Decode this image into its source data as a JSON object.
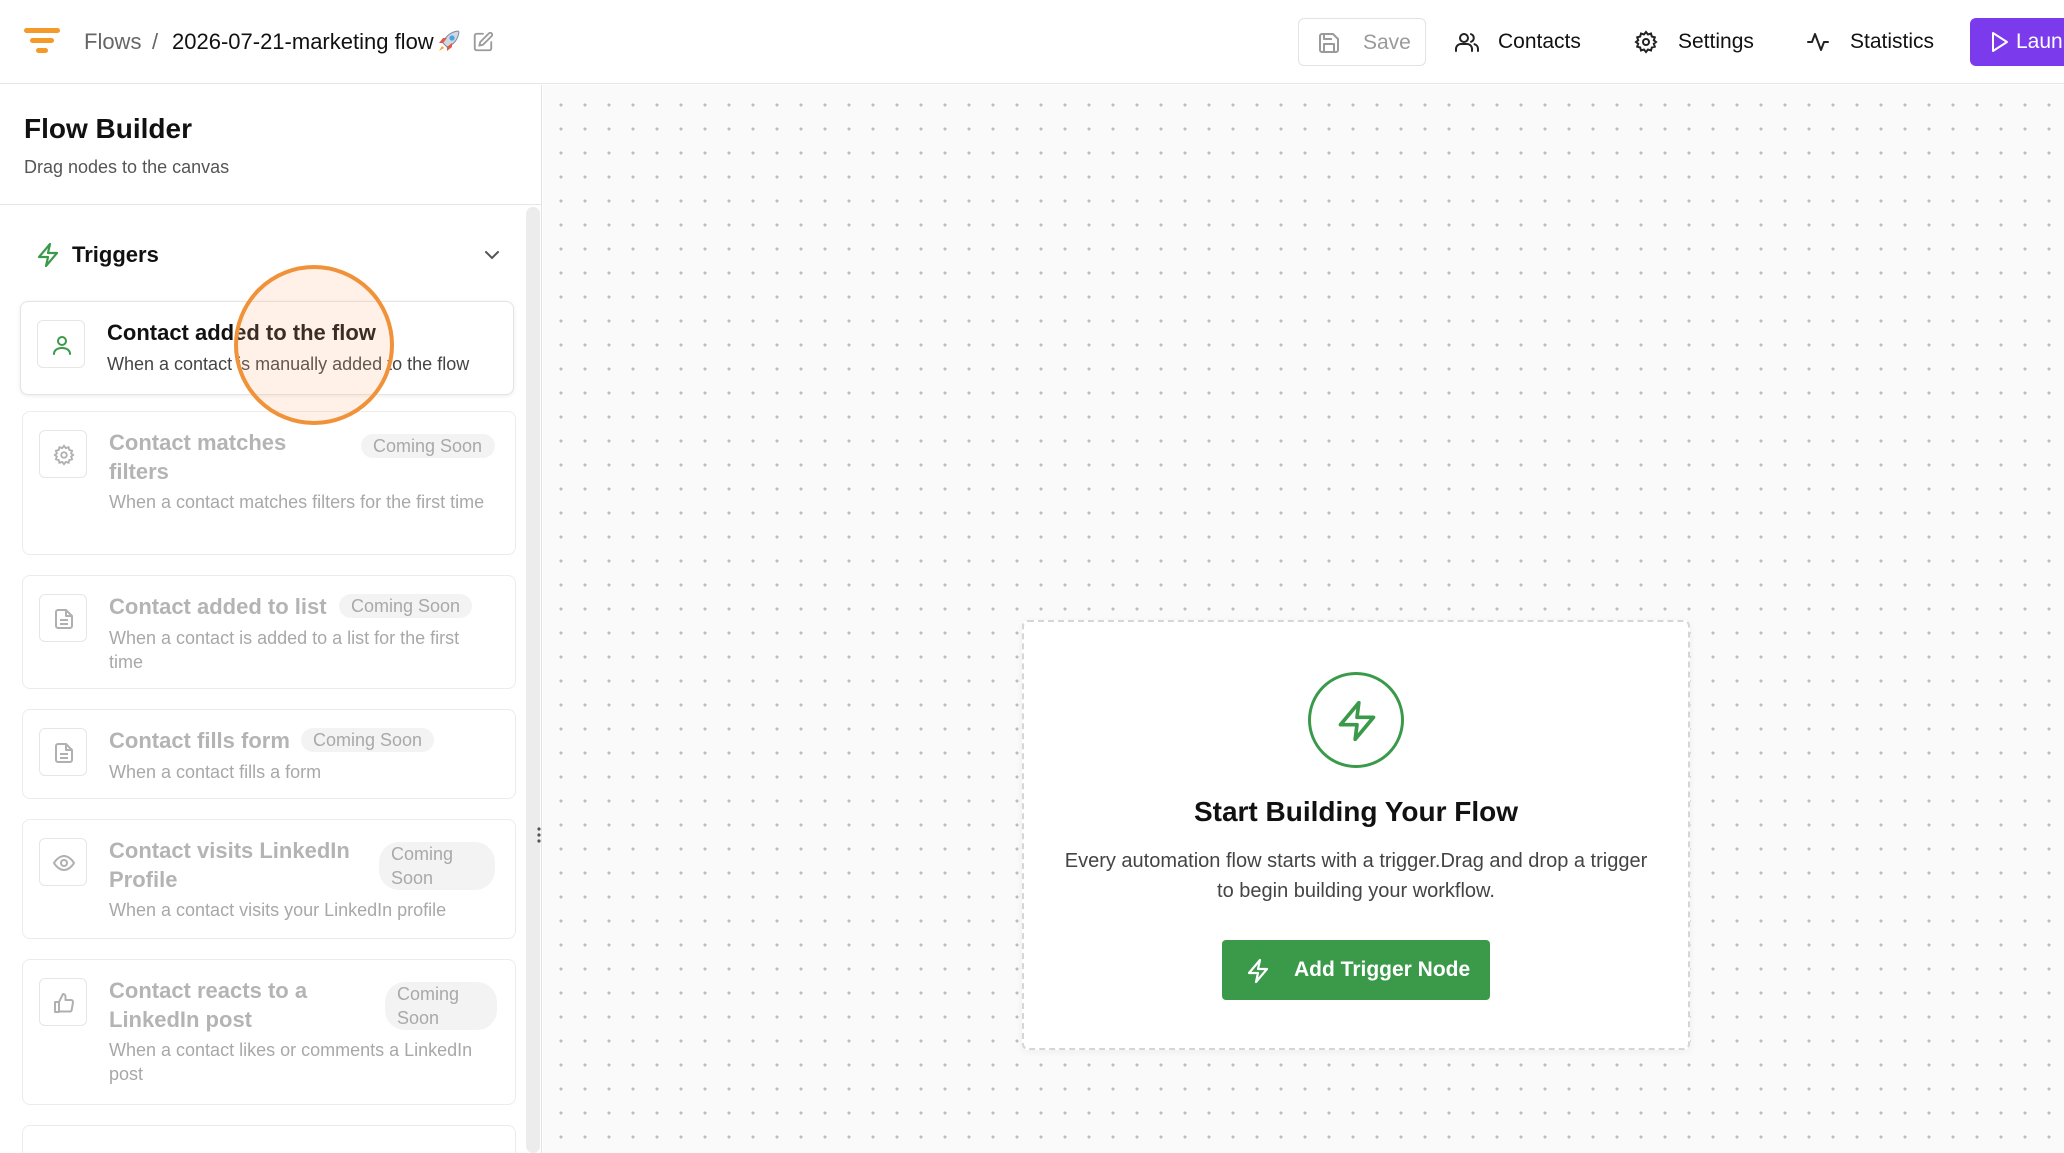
{
  "header": {
    "breadcrumb_root": "Flows",
    "breadcrumb_sep": "/",
    "flow_name": "2026-07-21-marketing flow",
    "actions": {
      "save": "Save",
      "contacts": "Contacts",
      "settings": "Settings",
      "statistics": "Statistics",
      "launch": "Laun"
    },
    "icons": {
      "logo": "funnel-logo",
      "rocket": "rocket-emoji",
      "edit": "pencil-icon"
    }
  },
  "sidebar": {
    "title": "Flow Builder",
    "subtitle": "Drag nodes to the canvas",
    "section": {
      "label": "Triggers",
      "expanded": true
    },
    "items": [
      {
        "title": "Contact added to the flow",
        "desc": "When a contact is manually added to the flow",
        "icon": "user-icon",
        "badge": ""
      },
      {
        "title": "Contact matches filters",
        "desc": "When a contact matches filters for the first time",
        "icon": "gear-icon",
        "badge": "Coming Soon"
      },
      {
        "title": "Contact added to list",
        "desc": "When a contact is added to a list for the first time",
        "icon": "document-icon",
        "badge": "Coming Soon"
      },
      {
        "title": "Contact fills form",
        "desc": "When a contact fills a form",
        "icon": "document-icon",
        "badge": "Coming Soon"
      },
      {
        "title": "Contact visits LinkedIn Profile",
        "desc": "When a contact visits your LinkedIn profile",
        "icon": "eye-icon",
        "badge": "Coming Soon"
      },
      {
        "title": "Contact reacts to a LinkedIn post",
        "desc": "When a contact likes or comments a LinkedIn post",
        "icon": "thumbs-up-icon",
        "badge": "Coming Soon"
      }
    ]
  },
  "canvas": {
    "empty_state": {
      "title": "Start Building Your Flow",
      "description": "Every automation flow starts with a trigger.Drag and drop a trigger to begin building your workflow.",
      "button": "Add Trigger Node"
    }
  },
  "colors": {
    "accent_green": "#3a9a4a",
    "launch_purple": "#7c3aed",
    "logo_orange": "#f39a2b",
    "cursor_highlight": "#f0923a"
  }
}
